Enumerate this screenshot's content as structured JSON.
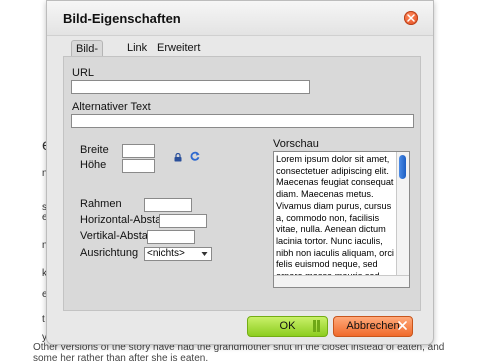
{
  "dialog": {
    "title": "Bild-Eigenschaften",
    "tabs": [
      {
        "label": "Bild-Info",
        "active": true
      },
      {
        "label": "Link",
        "active": false
      },
      {
        "label": "Erweitert",
        "active": false
      }
    ],
    "fields": {
      "url_label": "URL",
      "url_value": "",
      "alt_label": "Alternativer Text",
      "alt_value": "",
      "width_label": "Breite",
      "width_value": "",
      "height_label": "Höhe",
      "height_value": "",
      "border_label": "Rahmen",
      "border_value": "",
      "hspace_label": "Horizontal-Abstand",
      "hspace_value": "",
      "vspace_label": "Vertikal-Abstand",
      "vspace_value": "",
      "align_label": "Ausrichtung",
      "align_value": "<nichts>"
    },
    "preview": {
      "label": "Vorschau",
      "text": "Lorem ipsum dolor sit amet, consectetuer adipiscing elit. Maecenas feugiat consequat diam. Maecenas metus. Vivamus diam purus, cursus a, commodo non, facilisis vitae, nulla. Aenean dictum lacinia tortor. Nunc iaculis, nibh non iaculis aliquam, orci felis euismod neque, sed ornare massa mauris sed velit. Nulla pretium mi et risus. Fusce mi pede, tempor id, cursus"
    },
    "buttons": {
      "ok": "OK",
      "cancel": "Abbrechen"
    }
  },
  "background": {
    "line1": "Other versions of the story have had the grandmother shut in the closet instead of eaten, and",
    "line2": "some her rather than after she is eaten.",
    "fragments": [
      "e",
      "ng",
      "st",
      "e",
      "ng",
      "k",
      "e",
      "t y",
      "y"
    ]
  },
  "colors": {
    "ok_green": "#8ccd1f",
    "cancel_orange": "#f06a2b",
    "close_red": "#e0461a",
    "scroll_blue": "#1d5fc4"
  }
}
